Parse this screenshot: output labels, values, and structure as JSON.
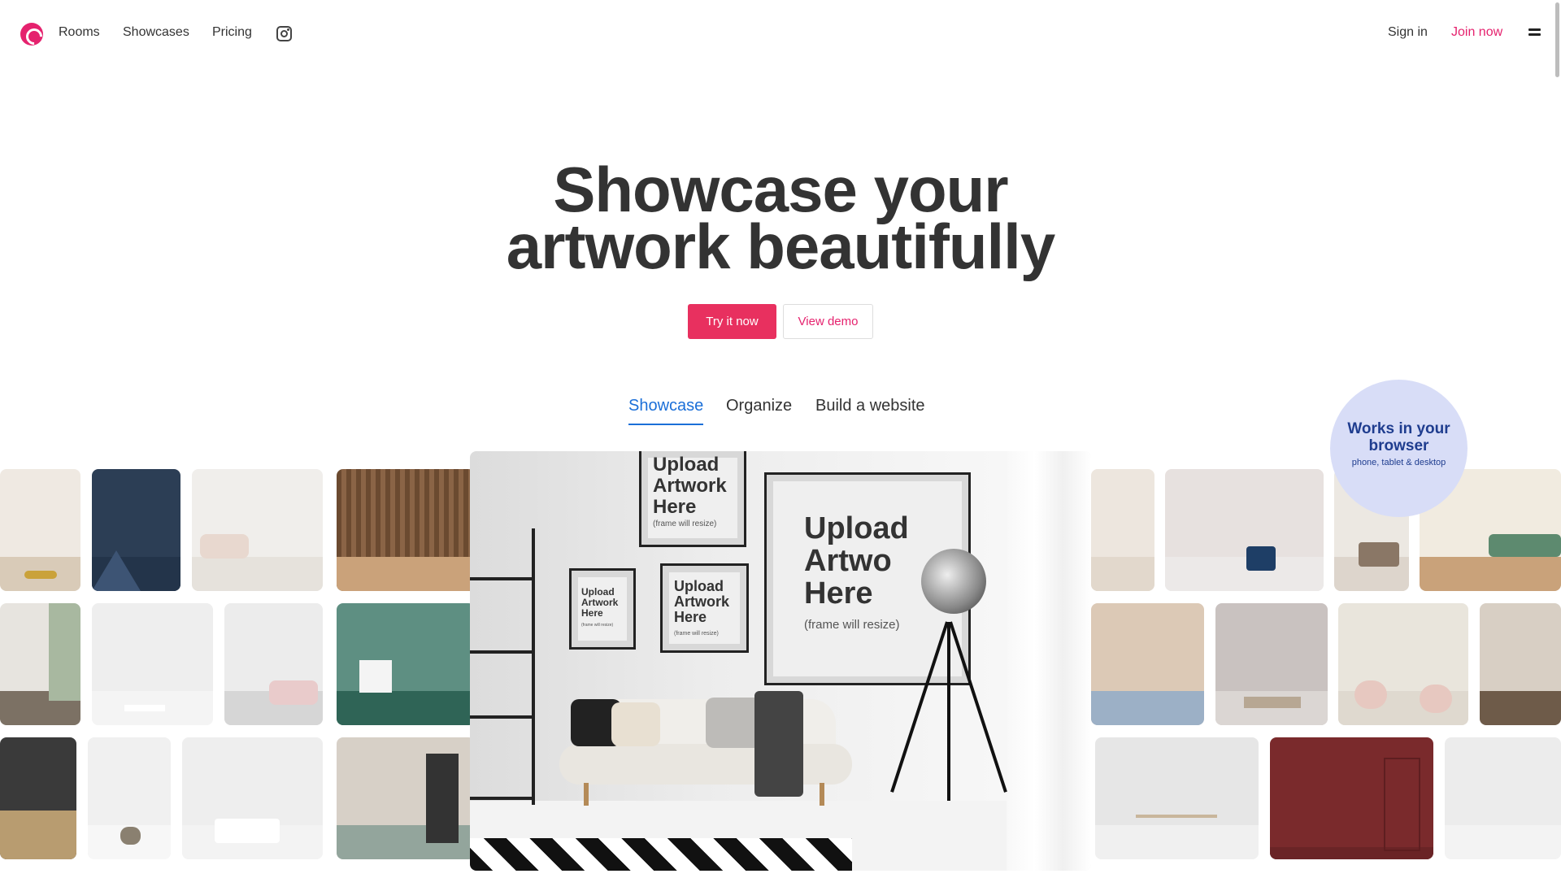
{
  "nav": {
    "rooms": "Rooms",
    "showcases": "Showcases",
    "pricing": "Pricing",
    "instagram_icon": "instagram-icon",
    "sign_in": "Sign in",
    "join_now": "Join now"
  },
  "hero": {
    "title_line1": "Showcase your",
    "title_line2": "artwork beautifully",
    "try_label": "Try it now",
    "demo_label": "View demo"
  },
  "tabs": [
    {
      "label": "Showcase",
      "active": true
    },
    {
      "label": "Organize",
      "active": false
    },
    {
      "label": "Build a website",
      "active": false
    }
  ],
  "badge": {
    "title": "Works in your browser",
    "subtitle": "phone, tablet & desktop"
  },
  "frames": {
    "main_title": "Upload Artwo Here",
    "main_sub": "(frame will resize)",
    "top_title": "Upload Artwork Here",
    "top_sub": "(frame will resize)",
    "mid_title": "Upload Artwork Here",
    "mid_sub": "(frame will resize)",
    "small_title": "Upload Artwork Here",
    "small_sub": "(frame will resize)"
  },
  "colors": {
    "brand": "#e5226e",
    "cta": "#e8305f",
    "tab_active": "#1b6fd8",
    "badge_bg": "#d8ddf7"
  }
}
